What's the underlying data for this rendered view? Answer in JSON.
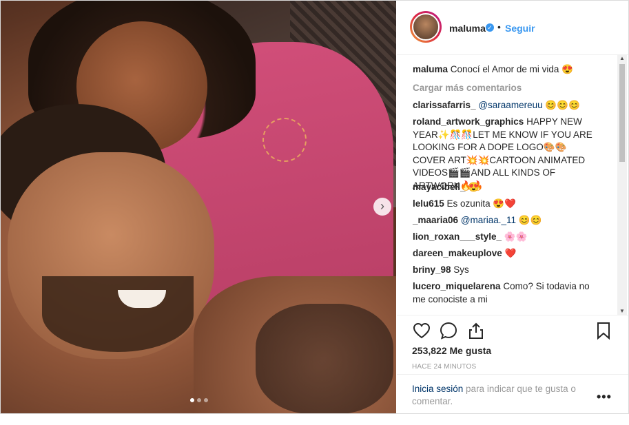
{
  "post": {
    "username": "maluma",
    "follow_label": "Seguir",
    "dot": "•"
  },
  "caption": {
    "user": "maluma",
    "text": "Conocí el Amor de mi vida 😍"
  },
  "load_more": "Cargar más comentarios",
  "comments": [
    {
      "user": "clarissafarris_",
      "mention": "@saraamereuu",
      "text": " 😊😊😊"
    },
    {
      "user": "roland_artwork_graphics",
      "mention": "",
      "text": "HAPPY NEW YEAR✨🎊🎊LET ME KNOW IF YOU ARE LOOKING FOR A DOPE LOGO🎨🎨 COVER ART💥💥CARTOON ANIMATED VIDEOS🎬🎬AND ALL KINDS OF ARTWORK🔥🔥"
    },
    {
      "user": "mayacibell_",
      "mention": "",
      "text": "😍"
    },
    {
      "user": "lelu615",
      "mention": "",
      "text": "Es ozunita 😍❤️"
    },
    {
      "user": "_maaria06",
      "mention": "@mariaa._11",
      "text": " 😊😊"
    },
    {
      "user": "lion_roxan___style_",
      "mention": "",
      "text": "🌸🌸"
    },
    {
      "user": "dareen_makeuplove",
      "mention": "",
      "text": "❤️"
    },
    {
      "user": "briny_98",
      "mention": "",
      "text": "Sys"
    },
    {
      "user": "lucero_miquelarena",
      "mention": "",
      "text": "Como? Si todavia no me conociste a mi"
    }
  ],
  "likes": "253,822 Me gusta",
  "timestamp": "HACE 24 MINUTOS",
  "login": {
    "link": "Inicia sesión",
    "rest": " para indicar que te gusta o comentar."
  },
  "more_label": "•••",
  "carousel": {
    "count": 3,
    "active": 1
  },
  "colors": {
    "link": "#3897f0",
    "muted": "#999999",
    "mention": "#003569"
  }
}
